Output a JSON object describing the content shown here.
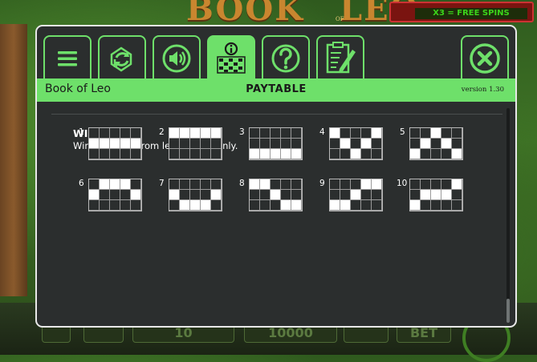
{
  "background": {
    "game_title_words": [
      "BOOK",
      "LEO"
    ],
    "game_subtitle": "OF",
    "free_spins_banner": "X3 = FREE SPINS",
    "bottom_values": [
      "10",
      "10000",
      "BET"
    ]
  },
  "tabs": [
    {
      "name": "menu",
      "icon": "menu-icon"
    },
    {
      "name": "autoplay",
      "icon": "autoplay-icon"
    },
    {
      "name": "sound",
      "icon": "speaker-icon"
    },
    {
      "name": "paytable",
      "icon": "paytable-icon",
      "active": true
    },
    {
      "name": "help",
      "icon": "help-icon"
    },
    {
      "name": "history",
      "icon": "history-icon"
    },
    {
      "name": "close",
      "icon": "close-icon"
    }
  ],
  "header": {
    "game_name": "Book of Leo",
    "title": "PAYTABLE",
    "version": "version 1.30"
  },
  "win_lines": {
    "heading": "WIN LINES",
    "description": "Win lines pay from left to right only.",
    "lines": [
      {
        "label": "1",
        "rows": [
          1,
          1,
          1,
          1,
          1
        ]
      },
      {
        "label": "2",
        "rows": [
          0,
          0,
          0,
          0,
          0
        ]
      },
      {
        "label": "3",
        "rows": [
          2,
          2,
          2,
          2,
          2
        ]
      },
      {
        "label": "4",
        "rows": [
          0,
          1,
          2,
          1,
          0
        ]
      },
      {
        "label": "5",
        "rows": [
          2,
          1,
          0,
          1,
          2
        ]
      },
      {
        "label": "6",
        "rows": [
          1,
          0,
          0,
          0,
          1
        ]
      },
      {
        "label": "7",
        "rows": [
          1,
          2,
          2,
          2,
          1
        ]
      },
      {
        "label": "8",
        "rows": [
          0,
          0,
          1,
          2,
          2
        ]
      },
      {
        "label": "9",
        "rows": [
          2,
          2,
          1,
          0,
          0
        ]
      },
      {
        "label": "10",
        "rows": [
          2,
          1,
          1,
          1,
          0
        ]
      }
    ]
  },
  "colors": {
    "accent": "#6ee06a",
    "panel": "#2b2e2e",
    "cell_on": "#ffffff"
  }
}
